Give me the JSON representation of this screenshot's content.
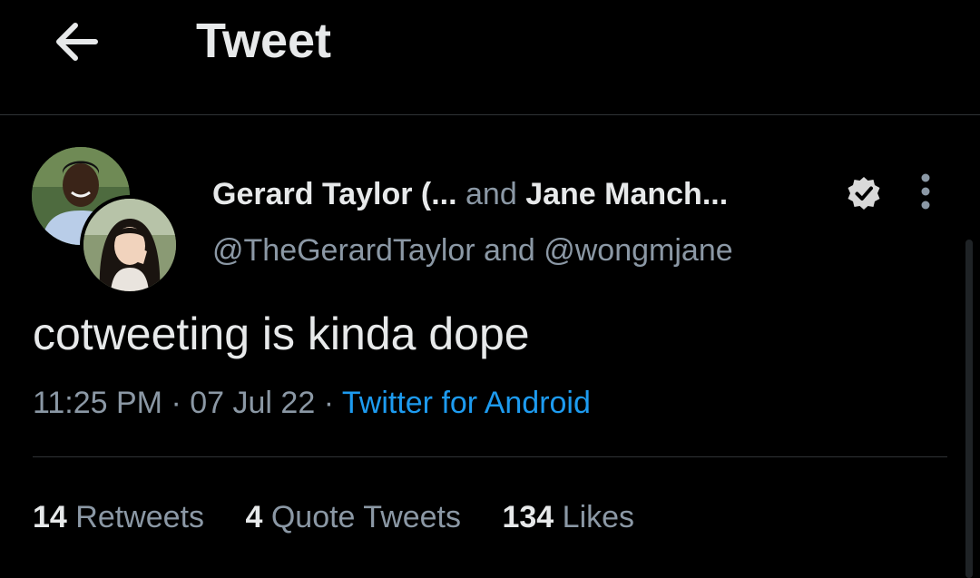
{
  "header": {
    "back_icon": "arrow-left-icon",
    "title": "Tweet"
  },
  "tweet": {
    "authors": {
      "first_name": "Gerard Taylor (...",
      "joiner": "and",
      "second_name": "Jane Manch...",
      "handles": "@TheGerardTaylor and @wongmjane"
    },
    "verified_icon": "verified-badge-icon",
    "more_icon": "more-vertical-icon",
    "text": "cotweeting is kinda dope",
    "meta": {
      "time": "11:25 PM",
      "separator": "·",
      "date": "07 Jul 22",
      "source": "Twitter for Android"
    },
    "stats": [
      {
        "count": "14",
        "label": "Retweets"
      },
      {
        "count": "4",
        "label": "Quote Tweets"
      },
      {
        "count": "134",
        "label": "Likes"
      }
    ]
  },
  "colors": {
    "background": "#000000",
    "text_primary": "#e7e9ea",
    "text_secondary": "#8b98a5",
    "link": "#1d9bf0",
    "divider": "#2f3336"
  }
}
